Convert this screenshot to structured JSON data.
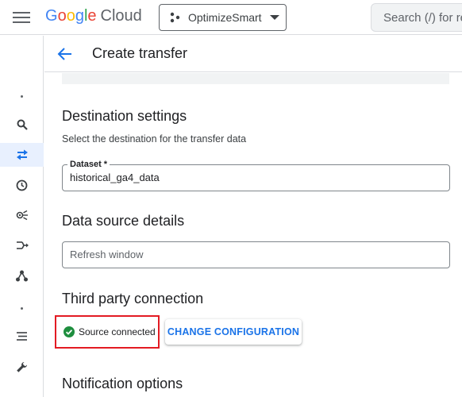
{
  "topbar": {
    "logo": {
      "letters": [
        "G",
        "o",
        "o",
        "g",
        "l",
        "e"
      ],
      "cloud": "Cloud"
    },
    "project": {
      "label": "OptimizeSmart"
    },
    "search": {
      "placeholder": "Search (/) for re"
    }
  },
  "header": {
    "title": "Create transfer"
  },
  "rail": {
    "items": [
      {
        "icon": "dot-icon"
      },
      {
        "icon": "search-icon"
      },
      {
        "icon": "transfer-icon",
        "active": true
      },
      {
        "icon": "clock-icon"
      },
      {
        "icon": "analytics-hub-icon"
      },
      {
        "icon": "pipeline-icon"
      },
      {
        "icon": "graph-icon"
      },
      {
        "icon": "dot-icon"
      },
      {
        "icon": "list-icon"
      },
      {
        "icon": "wrench-icon"
      }
    ]
  },
  "destination": {
    "title": "Destination settings",
    "subtitle": "Select the destination for the transfer data",
    "dataset_label": "Dataset *",
    "dataset_value": "historical_ga4_data"
  },
  "data_source": {
    "title": "Data source details",
    "refresh_placeholder": "Refresh window"
  },
  "third_party": {
    "title": "Third party connection",
    "status": "Source connected",
    "change_button": "CHANGE CONFIGURATION"
  },
  "notification": {
    "title": "Notification options"
  },
  "colors": {
    "accent": "#1a73e8",
    "success": "#1e8e3e",
    "highlight_border": "#e31b23",
    "active_rail": "#e8f0fe"
  }
}
